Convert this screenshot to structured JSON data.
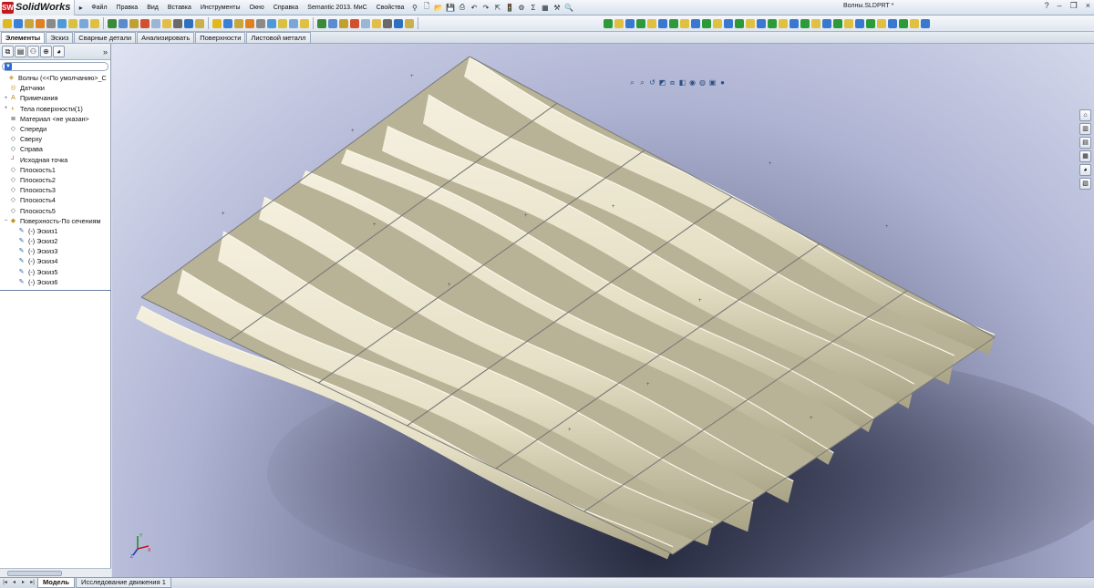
{
  "app": {
    "name": "SolidWorks",
    "document_title": "Волны.SLDPRT *"
  },
  "menu": [
    "Файл",
    "Правка",
    "Вид",
    "Вставка",
    "Инструменты",
    "Окно",
    "Справка",
    "Semantic 2013. МиС",
    "Свойства"
  ],
  "window_controls": {
    "help": "?",
    "minimize": "–",
    "restore": "❐",
    "close": "×"
  },
  "command_tabs": [
    "Элементы",
    "Эскиз",
    "Сварные детали",
    "Анализировать",
    "Поверхности",
    "Листовой металл"
  ],
  "active_command_tab": "Элементы",
  "panel": {
    "more": "»",
    "tree": [
      {
        "label": "Волны  (<<По умолчанию>_С",
        "icon": "part-icon",
        "level": 0,
        "expand": ""
      },
      {
        "label": "Датчики",
        "icon": "sensor-icon",
        "level": 1,
        "expand": ""
      },
      {
        "label": "Примечания",
        "icon": "annotation-icon",
        "level": 1,
        "expand": "+"
      },
      {
        "label": "Тела поверхности(1)",
        "icon": "surface-bodies-icon",
        "level": 1,
        "expand": "+"
      },
      {
        "label": "Материал <не указан>",
        "icon": "material-icon",
        "level": 1,
        "expand": ""
      },
      {
        "label": "Спереди",
        "icon": "plane-icon",
        "level": 1,
        "expand": ""
      },
      {
        "label": "Сверху",
        "icon": "plane-icon",
        "level": 1,
        "expand": ""
      },
      {
        "label": "Справа",
        "icon": "plane-icon",
        "level": 1,
        "expand": ""
      },
      {
        "label": "Исходная точка",
        "icon": "origin-icon",
        "level": 1,
        "expand": ""
      },
      {
        "label": "Плоскость1",
        "icon": "plane-icon",
        "level": 1,
        "expand": ""
      },
      {
        "label": "Плоскость2",
        "icon": "plane-icon",
        "level": 1,
        "expand": ""
      },
      {
        "label": "Плоскость3",
        "icon": "plane-icon",
        "level": 1,
        "expand": ""
      },
      {
        "label": "Плоскость4",
        "icon": "plane-icon",
        "level": 1,
        "expand": ""
      },
      {
        "label": "Плоскость5",
        "icon": "plane-icon",
        "level": 1,
        "expand": ""
      },
      {
        "label": "Поверхность-По сечениям",
        "icon": "loft-surface-icon",
        "level": 1,
        "expand": "–"
      },
      {
        "label": "(-) Эскиз1",
        "icon": "sketch-icon",
        "level": 2,
        "expand": ""
      },
      {
        "label": "(-) Эскиз2",
        "icon": "sketch-icon",
        "level": 2,
        "expand": ""
      },
      {
        "label": "(-) Эскиз3",
        "icon": "sketch-icon",
        "level": 2,
        "expand": ""
      },
      {
        "label": "(-) Эскиз4",
        "icon": "sketch-icon",
        "level": 2,
        "expand": ""
      },
      {
        "label": "(-) Эскиз5",
        "icon": "sketch-icon",
        "level": 2,
        "expand": ""
      },
      {
        "label": "(-) Эскиз6",
        "icon": "sketch-icon",
        "level": 2,
        "expand": ""
      }
    ]
  },
  "triad": {
    "x": "X",
    "y": "Y",
    "z": "Z"
  },
  "bottom_tabs": [
    "Модель",
    "Исследование движения 1"
  ],
  "active_bottom_tab": "Модель",
  "colors": {
    "surface": "#ebe6d0",
    "surface_shadow": "#b8b296",
    "edge": "#7a7a78",
    "background_top": "#dfe3f2",
    "background_bottom": "#2b2f44"
  }
}
